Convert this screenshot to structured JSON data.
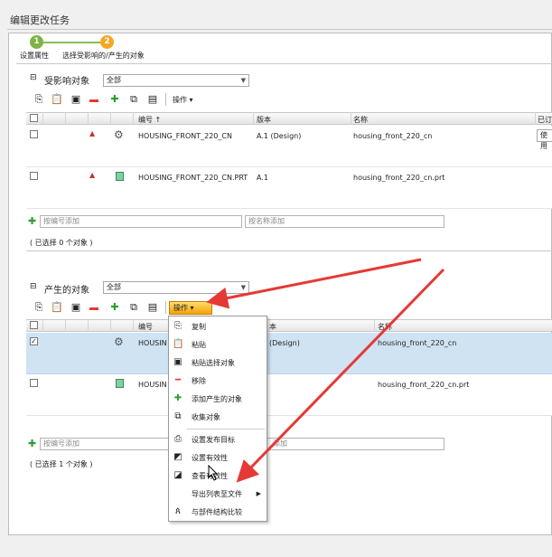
{
  "title": "编辑更改任务",
  "wizard": {
    "step1": {
      "num": "1",
      "label": "设置属性",
      "color": "#7cb342"
    },
    "step2": {
      "num": "2",
      "label": "选择受影响的/产生的对象",
      "color": "#f5a623"
    }
  },
  "affected": {
    "section_title": "受影响对象",
    "filter": "全部",
    "ops_label": "操作",
    "headers": {
      "number": "编号",
      "sort_arrow": "↑",
      "version": "版本",
      "name": "名称",
      "extra": "已订"
    },
    "rows": [
      {
        "number": "HOUSING_FRONT_220_CN",
        "version": "A.1 (Design)",
        "name": "housing_front_220_cn",
        "extra": "使用"
      },
      {
        "number": "HOUSING_FRONT_220_CN.PRT",
        "version": "A.1",
        "name": "housing_front_220_cn.prt"
      }
    ],
    "add_number_placeholder": "按编号添加",
    "add_name_placeholder": "按名称添加",
    "status": "( 已选择 0 个对象 )"
  },
  "resulting": {
    "section_title": "产生的对象",
    "filter": "全部",
    "ops_label": "操作",
    "headers": {
      "number": "编号",
      "version_partial": "本",
      "name": "名称"
    },
    "rows": [
      {
        "number": "HOUSIN",
        "version": "(Design)",
        "name": "housing_front_220_cn",
        "selected": true
      },
      {
        "number": "HOUSIN",
        "version": "",
        "name": "housing_front_220_cn.prt",
        "selected": false
      }
    ],
    "add_number_placeholder": "按编号添加",
    "add_name_placeholder": "添加",
    "status": "( 已选择 1 个对象 )"
  },
  "menu": {
    "items": [
      "复制",
      "粘贴",
      "粘贴选择对象",
      "移除",
      "添加产生的对象",
      "收集对象",
      "设置发布目标",
      "设置有效性",
      "查看有效性",
      "导出列表至文件",
      "与部件结构比较"
    ]
  },
  "colors": {
    "selection": "#cfe3f3",
    "arrow": "#e53935",
    "remove": "#e53935",
    "add": "#2e9e2e"
  }
}
